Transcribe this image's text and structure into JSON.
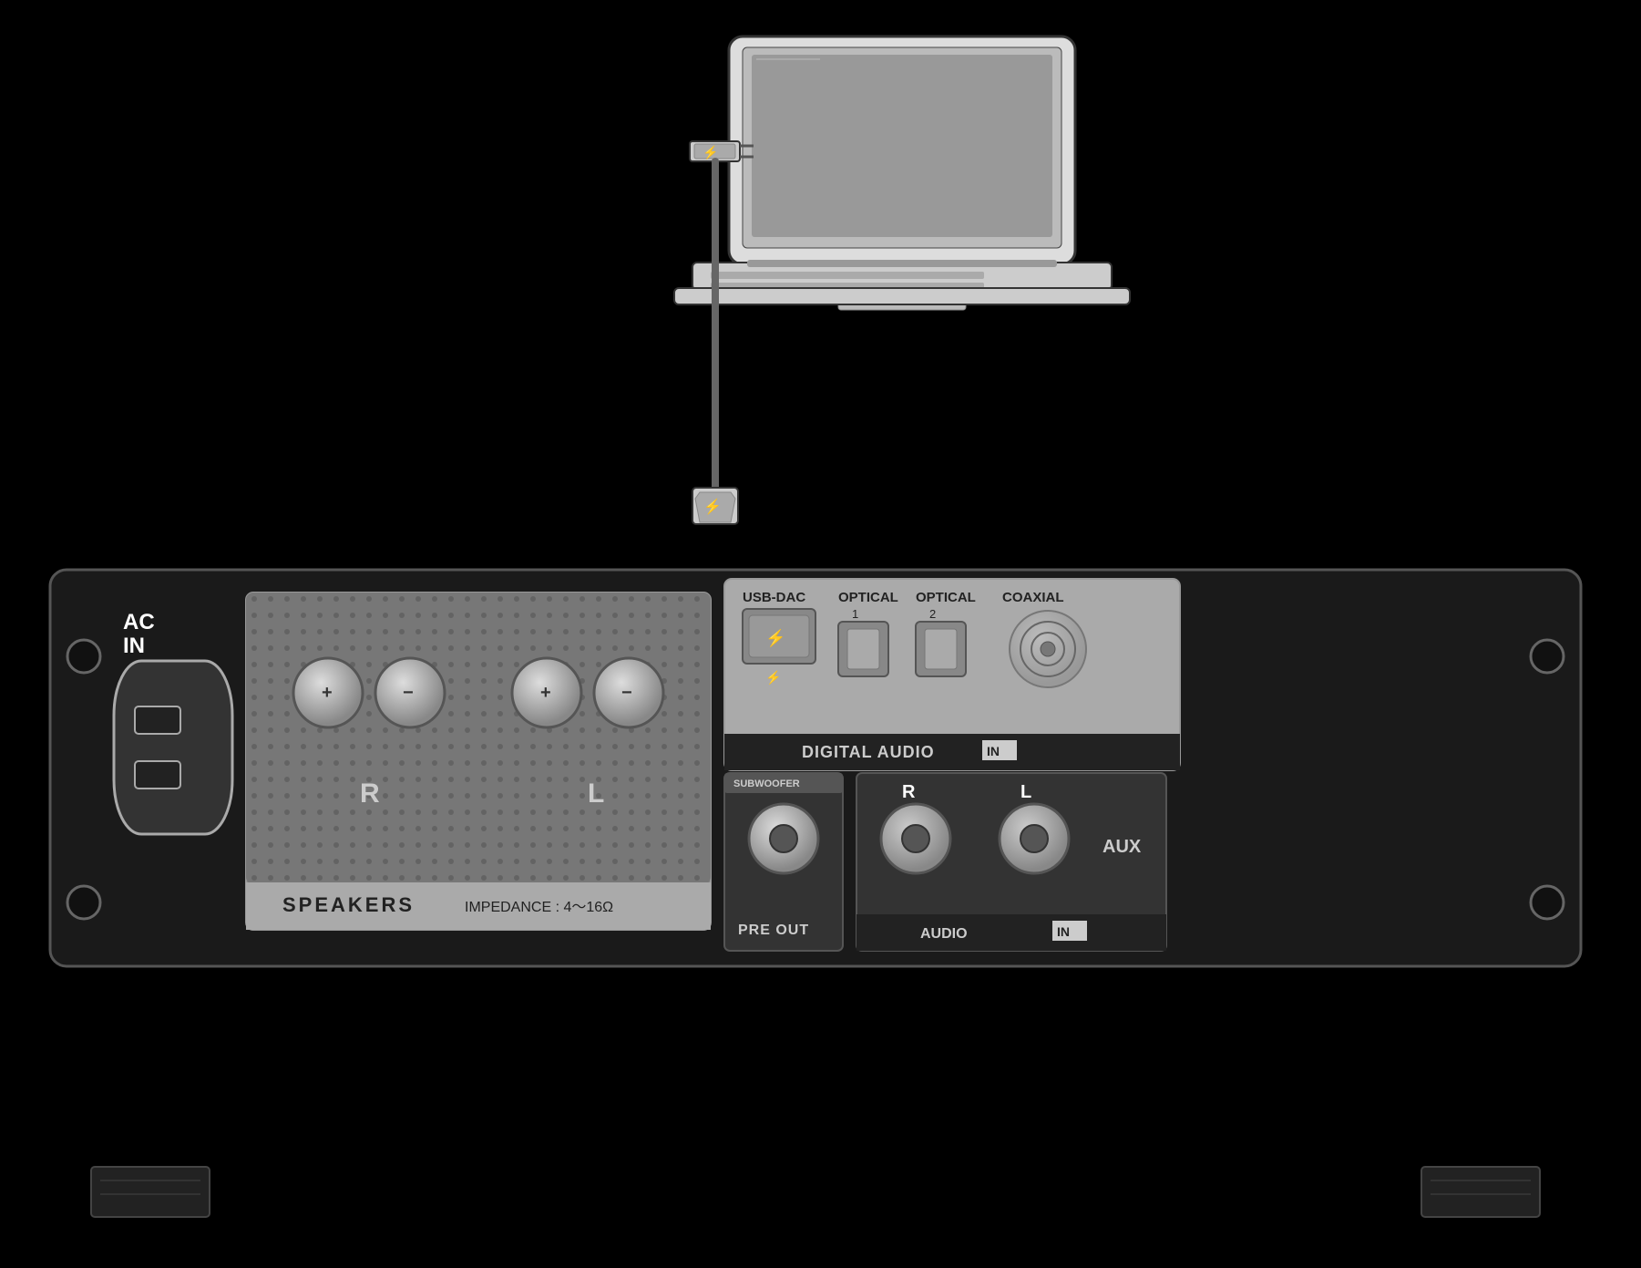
{
  "background_color": "#000000",
  "labels": {
    "ac_in_line1": "AC",
    "ac_in_line2": "IN",
    "speakers": "SPEAKERS",
    "impedance": "IMPEDANCE : 4～16Ω",
    "pre_out": "PRE OUT",
    "subwoofer": "SUBWOOFER",
    "digital_audio": "DIGITAL AUDIO",
    "digital_in": "IN",
    "audio_in": "AUDIO",
    "audio_in_badge": "IN",
    "usb_dac": "USB-DAC",
    "optical1": "OPTICAL",
    "optical1_num": "1",
    "optical2": "OPTICAL",
    "optical2_num": "2",
    "coaxial": "COAXIAL",
    "rca_r": "R",
    "rca_l": "L",
    "aux": "AUX",
    "sp_r": "R",
    "sp_l": "L",
    "sp_plus": "+",
    "sp_minus": "−",
    "usb_symbol": "⚡"
  },
  "colors": {
    "background": "#000000",
    "panel_dark": "#1a1a1a",
    "panel_mid": "#888888",
    "panel_light": "#aaaaaa",
    "text_white": "#ffffff",
    "text_dark": "#222222",
    "accent_gray": "#555555"
  }
}
